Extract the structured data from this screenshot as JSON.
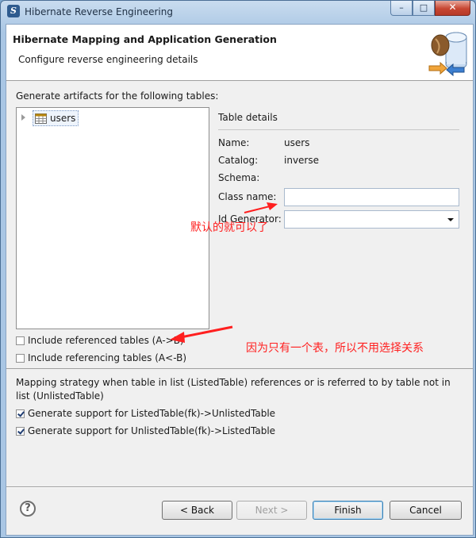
{
  "window": {
    "title": "Hibernate Reverse Engineering",
    "icon": "hibernate-app-icon"
  },
  "titlebar_buttons": {
    "minimize": "–",
    "maximize": "□",
    "close": "✕"
  },
  "header": {
    "title": "Hibernate Mapping and Application Generation",
    "subtitle": "Configure reverse engineering details",
    "banner_icon": "database-wizard-icon"
  },
  "artifacts": {
    "label": "Generate artifacts for the following tables:",
    "tree_items": [
      {
        "label": "users",
        "icon": "table-icon"
      }
    ]
  },
  "table_details": {
    "heading": "Table details",
    "name_label": "Name:",
    "name_value": "users",
    "catalog_label": "Catalog:",
    "catalog_value": "inverse",
    "schema_label": "Schema:",
    "schema_value": "",
    "class_name_label": "Class name:",
    "class_name_value": "",
    "id_generator_label": "Id Generator:",
    "id_generator_value": ""
  },
  "options": {
    "include_referenced": {
      "label": "Include referenced tables (A->B)",
      "checked": false
    },
    "include_referencing": {
      "label": "Include referencing tables (A<-B)",
      "checked": false
    }
  },
  "mapping": {
    "description": "Mapping strategy when table in list (ListedTable) references or is referred to by table not in list (UnlistedTable)",
    "support_listed": {
      "label": "Generate support for ListedTable(fk)->UnlistedTable",
      "checked": true
    },
    "support_unlisted": {
      "label": "Generate support for UnlistedTable(fk)->ListedTable",
      "checked": true
    }
  },
  "annotations": {
    "default_note": "默认的就可以了",
    "single_table_note": "因为只有一个表，所以不用选择关系",
    "color": "#ff1f1f"
  },
  "footer": {
    "help": "?",
    "back": "< Back",
    "next": "Next >",
    "finish": "Finish",
    "cancel": "Cancel"
  }
}
